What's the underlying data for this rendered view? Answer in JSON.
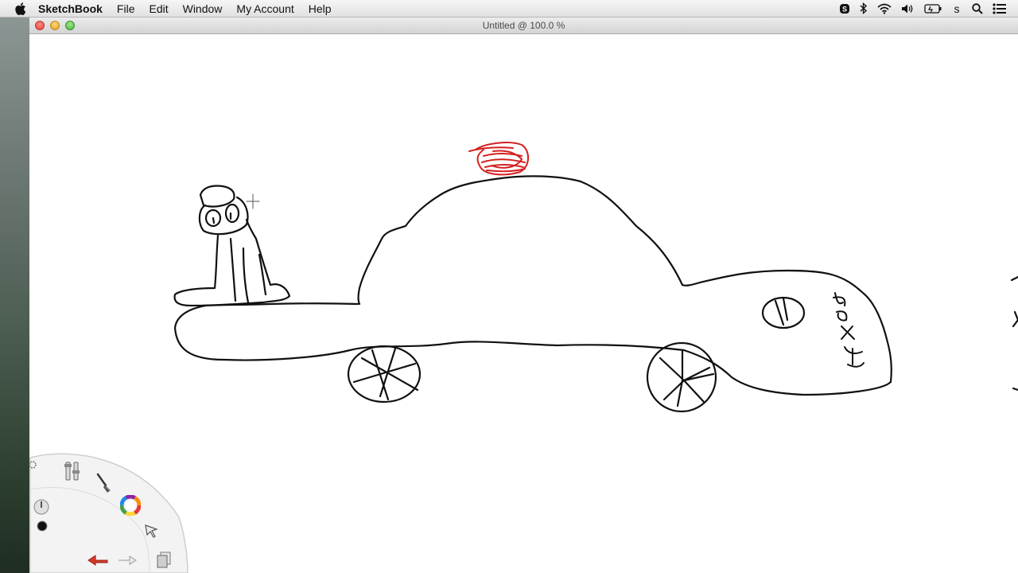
{
  "menubar": {
    "app_name": "SketchBook",
    "items": [
      "File",
      "Edit",
      "Window",
      "My Account",
      "Help"
    ],
    "user_initial": "s",
    "status_icons": [
      "skype-icon",
      "bluetooth-icon",
      "wifi-icon",
      "volume-icon",
      "battery-icon",
      "user-menu",
      "spotlight-icon",
      "notification-center-icon"
    ]
  },
  "window": {
    "title": "Untitled @ 100.0 %"
  },
  "canvas": {
    "drawing": "car-with-figure-sketch",
    "ink_color": "#111111",
    "siren_color": "#d42020",
    "handwritten_text": "sexy"
  },
  "lagoon": {
    "tools": [
      "brush-properties-icon",
      "paintbrush-icon",
      "color-wheel-icon",
      "pointer-icon",
      "layers-icon",
      "redo-icon",
      "undo-icon",
      "current-color-swatch",
      "brush-size-icon",
      "settings-gear-icon"
    ]
  },
  "colors": {
    "menubar_bg": "#e8e8e8",
    "titlebar_bg": "#dedede",
    "canvas_bg": "#ffffff",
    "undo_red": "#d43a2a"
  }
}
